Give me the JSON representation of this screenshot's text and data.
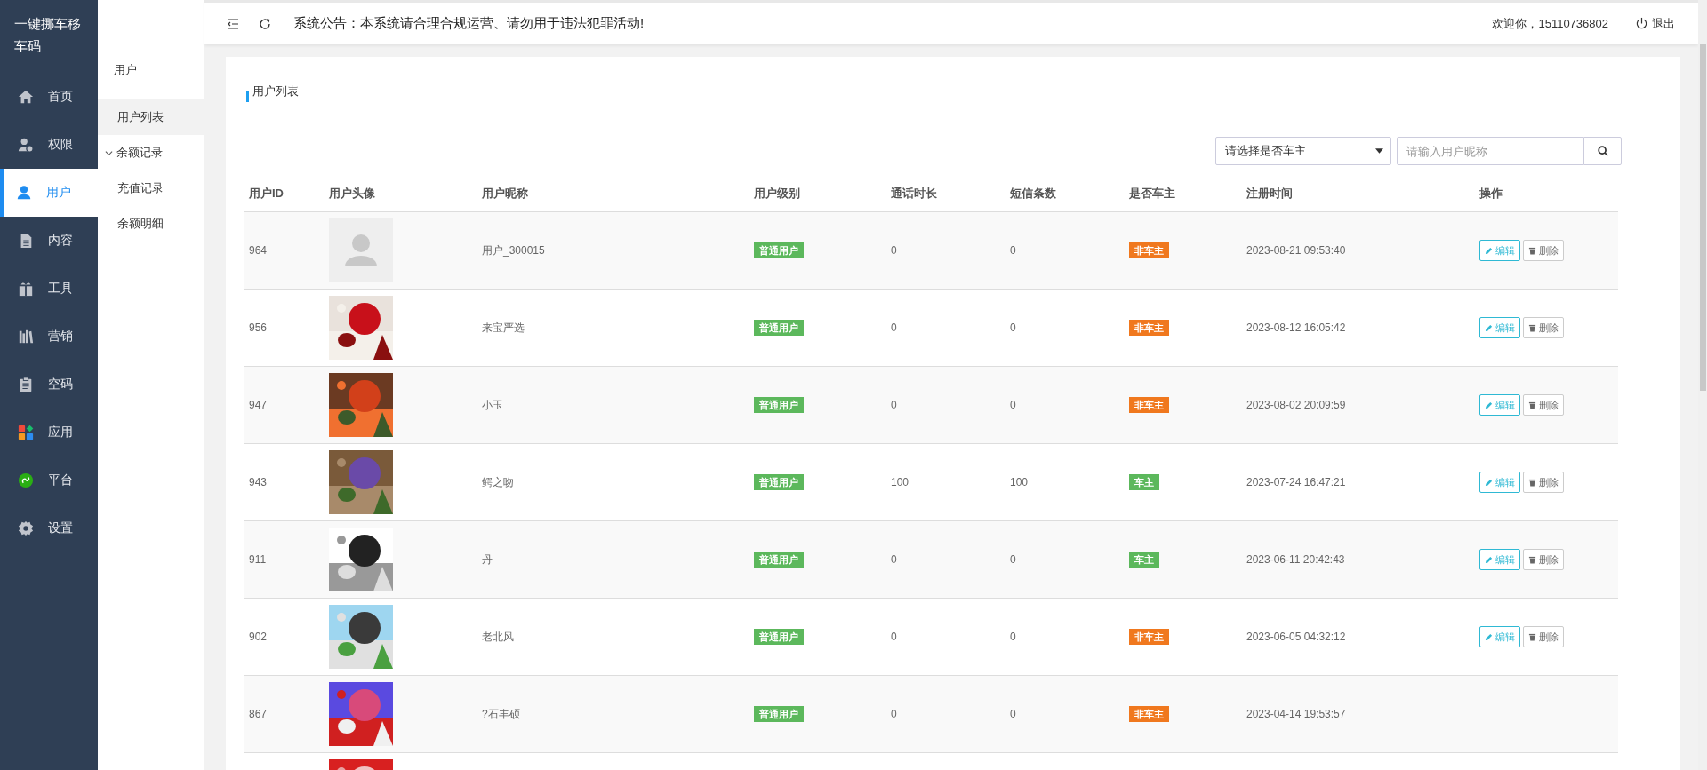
{
  "brand": {
    "title": "一键挪车移车码"
  },
  "sidebar": {
    "items": [
      {
        "label": "首页",
        "selected": false
      },
      {
        "label": "权限",
        "selected": false
      },
      {
        "label": "用户",
        "selected": true
      },
      {
        "label": "内容",
        "selected": false
      },
      {
        "label": "工具",
        "selected": false
      },
      {
        "label": "营销",
        "selected": false
      },
      {
        "label": "空码",
        "selected": false
      },
      {
        "label": "应用",
        "selected": false
      },
      {
        "label": "平台",
        "selected": false
      },
      {
        "label": "设置",
        "selected": false
      }
    ]
  },
  "submenu": {
    "title": "用户",
    "items": [
      {
        "label": "用户列表",
        "selected": true
      },
      {
        "label": "余额记录",
        "selected": false,
        "expanded": true,
        "children": [
          {
            "label": "充值记录",
            "selected": false
          },
          {
            "label": "余额明细",
            "selected": false
          }
        ]
      }
    ]
  },
  "header": {
    "notice": "系统公告：本系统请合理合规运营、请勿用于违法犯罪活动!",
    "welcome": "欢迎你，15110736802",
    "logout": "退出"
  },
  "card": {
    "title": "用户列表"
  },
  "filter": {
    "select": "请选择是否车主",
    "search_placeholder": "请输入用户昵称"
  },
  "table": {
    "columns": [
      "用户ID",
      "用户头像",
      "用户昵称",
      "用户级别",
      "通话时长",
      "短信条数",
      "是否车主",
      "注册时间",
      "操作"
    ],
    "rows": [
      {
        "id": "964",
        "avatar": {
          "kind": "placeholder"
        },
        "nickname": "用户_300015",
        "level": "普通用户",
        "calls": "0",
        "sms": "0",
        "owner": {
          "text": "非车主",
          "is_owner": false
        },
        "time": "2023-08-21 09:53:40",
        "actions": [
          {
            "label": "编辑",
            "kind": "edit"
          },
          {
            "label": "删除",
            "kind": "delete"
          }
        ]
      },
      {
        "id": "956",
        "avatar": {
          "kind": "picture"
        },
        "nickname": "来宝严选",
        "level": "普通用户",
        "calls": "0",
        "sms": "0",
        "owner": {
          "text": "非车主",
          "is_owner": false
        },
        "time": "2023-08-12 16:05:42",
        "actions": [
          {
            "label": "编辑",
            "kind": "edit"
          },
          {
            "label": "删除",
            "kind": "delete"
          }
        ]
      },
      {
        "id": "947",
        "avatar": {
          "kind": "picture"
        },
        "nickname": "小玉",
        "level": "普通用户",
        "calls": "0",
        "sms": "0",
        "owner": {
          "text": "非车主",
          "is_owner": false
        },
        "time": "2023-08-02 20:09:59",
        "actions": [
          {
            "label": "编辑",
            "kind": "edit"
          },
          {
            "label": "删除",
            "kind": "delete"
          }
        ]
      },
      {
        "id": "943",
        "avatar": {
          "kind": "picture"
        },
        "nickname": "鳄之吻",
        "level": "普通用户",
        "calls": "100",
        "sms": "100",
        "owner": {
          "text": "车主",
          "is_owner": true
        },
        "time": "2023-07-24 16:47:21",
        "actions": [
          {
            "label": "编辑",
            "kind": "edit"
          },
          {
            "label": "删除",
            "kind": "delete"
          }
        ]
      },
      {
        "id": "911",
        "avatar": {
          "kind": "picture"
        },
        "nickname": "丹",
        "level": "普通用户",
        "calls": "0",
        "sms": "0",
        "owner": {
          "text": "车主",
          "is_owner": true
        },
        "time": "2023-06-11 20:42:43",
        "actions": [
          {
            "label": "编辑",
            "kind": "edit"
          },
          {
            "label": "删除",
            "kind": "delete"
          }
        ]
      },
      {
        "id": "902",
        "avatar": {
          "kind": "picture"
        },
        "nickname": "老北风",
        "level": "普通用户",
        "calls": "0",
        "sms": "0",
        "owner": {
          "text": "非车主",
          "is_owner": false
        },
        "time": "2023-06-05 04:32:12",
        "actions": [
          {
            "label": "编辑",
            "kind": "edit"
          },
          {
            "label": "删除",
            "kind": "delete"
          }
        ]
      },
      {
        "id": "867",
        "avatar": {
          "kind": "picture"
        },
        "nickname": "?石丰硕",
        "level": "普通用户",
        "calls": "0",
        "sms": "0",
        "owner": {
          "text": "非车主",
          "is_owner": false
        },
        "time": "2023-04-14 19:53:57"
      },
      {
        "avatar": {
          "kind": "picture"
        }
      }
    ]
  }
}
